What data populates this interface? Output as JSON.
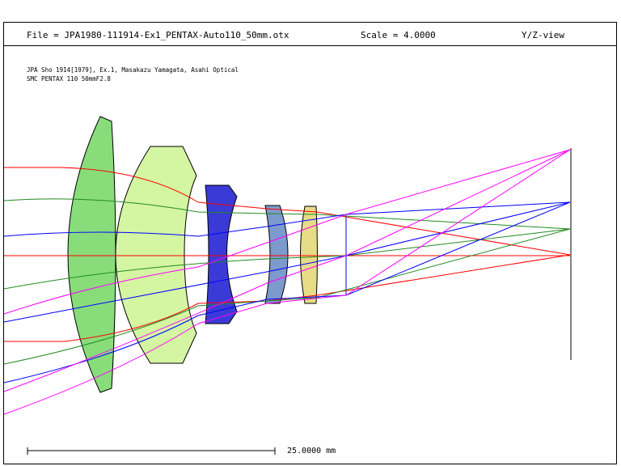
{
  "header": {
    "file": "File = JPA1980-111914-Ex1_PENTAX-Auto110_50mm.otx",
    "scale": "Scale = 4.0000",
    "view": "Y/Z-view"
  },
  "subtitle": {
    "line1": "JPA Sho 1914[1979], Ex.1, Masakazu Yamagata, Asahi Optical",
    "line2": "SMC PENTAX 110 50mmF2.8"
  },
  "scale_bar": {
    "label": "25.0000 mm"
  },
  "colors": {
    "element1": "#88dd7a",
    "element2": "#d4f5a2",
    "element3": "#3a3ad6",
    "element4": "#7d9acd",
    "element5": "#e6dc86",
    "ray_red": "#ff0000",
    "ray_green": "#228b22",
    "ray_blue": "#0000ff",
    "ray_magenta": "#ff00ff"
  }
}
